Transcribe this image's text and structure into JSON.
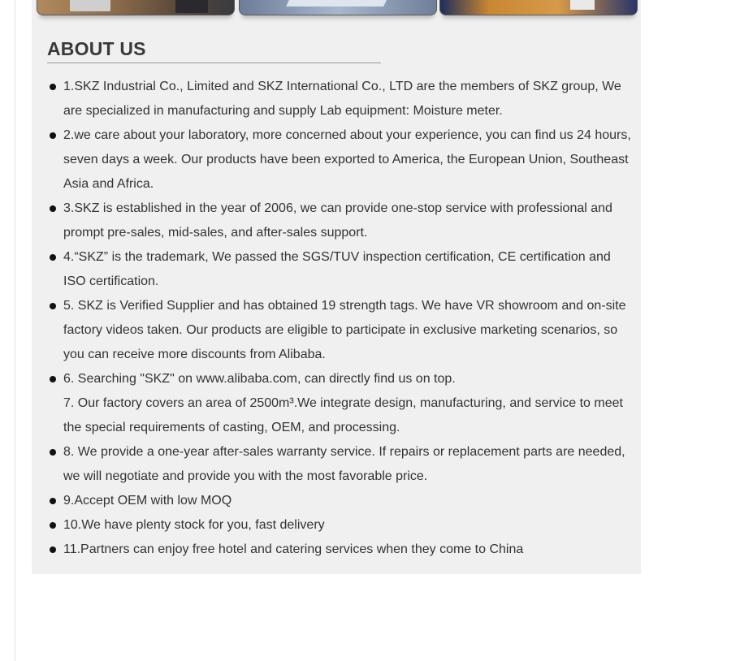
{
  "about": {
    "heading": "ABOUT US",
    "items": [
      {
        "text": "1.SKZ Industrial Co., Limited and SKZ International Co., LTD are the members of SKZ group, We are specialized in manufacturing and supply Lab equipment: Moisture meter.",
        "bullet": true
      },
      {
        "text": "2.we care about your laboratory, more concerned about your experience, you can find us 24 hours, seven days a week. Our products have been exported to America, the European Union, Southeast Asia and Africa.",
        "bullet": true
      },
      {
        "text": "3.SKZ is established in the year of 2006, we can provide one-stop service with professional and prompt pre-sales, mid-sales, and after-sales support.",
        "bullet": true
      },
      {
        "text": "4.“SKZ” is the trademark, We passed the SGS/TUV inspection certification, CE certification and ISO certification.",
        "bullet": true
      },
      {
        "text": "5. SKZ is Verified Supplier and has obtained 19 strength tags. We have VR showroom and on-site factory videos taken. Our products are eligible to participate in exclusive marketing scenarios, so you can receive more discounts from Alibaba.",
        "bullet": true
      },
      {
        "text": "6. Searching \"SKZ\" on www.alibaba.com, can directly find us on top.",
        "bullet": true
      },
      {
        "text": "7. Our factory covers an area of 2500m³.We integrate design, manufacturing, and service to meet the special requirements of casting, OEM, and processing.",
        "bullet": false
      },
      {
        "text": "8. We provide a one-year after-sales warranty service. If repairs or replacement parts are needed, we will negotiate and provide you with the most favorable price.",
        "bullet": true
      },
      {
        "text": "9.Accept OEM with low MOQ",
        "bullet": true
      },
      {
        "text": "10.We have plenty stock for you, fast delivery",
        "bullet": true
      },
      {
        "text": "11.Partners can enjoy free hotel and catering services when they come to China",
        "bullet": true
      }
    ]
  }
}
